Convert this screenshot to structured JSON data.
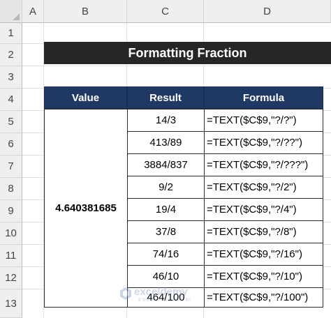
{
  "columns": [
    "A",
    "B",
    "C",
    "D"
  ],
  "rows": [
    "1",
    "2",
    "3",
    "4",
    "5",
    "6",
    "7",
    "8",
    "9",
    "10",
    "11",
    "12",
    "13"
  ],
  "title": "Formatting Fraction",
  "table": {
    "headers": {
      "value": "Value",
      "result": "Result",
      "formula": "Formula"
    },
    "value": "4.640381685",
    "entries": [
      {
        "result": "14/3",
        "formula": "=TEXT($C$9,\"?/?\")"
      },
      {
        "result": "413/89",
        "formula": "=TEXT($C$9,\"?/??\")"
      },
      {
        "result": "3884/837",
        "formula": "=TEXT($C$9,\"?/???\")"
      },
      {
        "result": "9/2",
        "formula": "=TEXT($C$9,\"?/2\")"
      },
      {
        "result": "19/4",
        "formula": "=TEXT($C$9,\"?/4\")"
      },
      {
        "result": "37/8",
        "formula": "=TEXT($C$9,\"?/8\")"
      },
      {
        "result": "74/16",
        "formula": "=TEXT($C$9,\"?/16\")"
      },
      {
        "result": "46/10",
        "formula": "=TEXT($C$9,\"?/10\")"
      },
      {
        "result": "464/100",
        "formula": "=TEXT($C$9,\"?/100\")"
      }
    ]
  },
  "watermark": {
    "name": "exceldemy",
    "tagline": "EXCEL · DATA · BI"
  },
  "colors": {
    "header_bg": "#203864",
    "title_bg": "#262626"
  }
}
